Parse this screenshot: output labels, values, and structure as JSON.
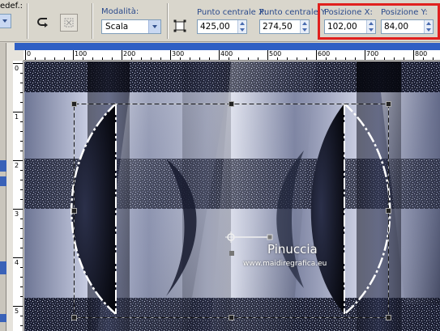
{
  "toolbar": {
    "preset_label": "edef.:",
    "mode": {
      "label": "Modalità:",
      "value": "Scala"
    },
    "center_x": {
      "label": "Punto centrale X:",
      "value": "425,00"
    },
    "center_y": {
      "label": "Punto centrale Y",
      "value": "274,50"
    },
    "pos_x": {
      "label": "Posizione X:",
      "value": "102,00"
    },
    "pos_y": {
      "label": "Posizione Y:",
      "value": "84,00"
    }
  },
  "ruler": {
    "horizontal": [
      "0",
      "100",
      "200",
      "300",
      "400",
      "500",
      "600",
      "700",
      "800"
    ],
    "vertical": [
      "0",
      "1",
      "2",
      "3",
      "4",
      "5"
    ]
  },
  "canvas": {
    "watermark_title": "Pinuccia",
    "watermark_url": "www.maidiregrafica.eu"
  },
  "colors": {
    "highlight": "#e0201e",
    "accent": "#2f5fc4"
  }
}
